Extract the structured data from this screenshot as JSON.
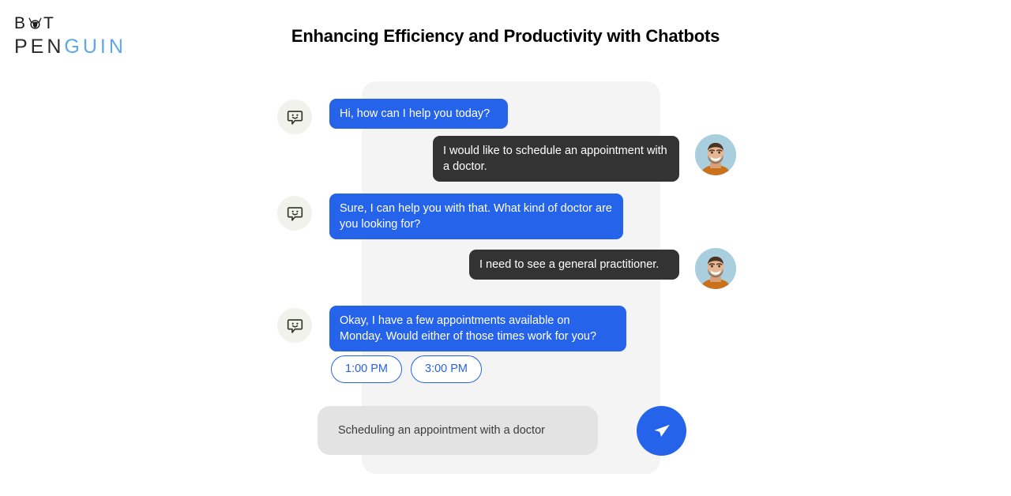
{
  "brand": {
    "line1_prefix": "B",
    "line1_suffix": "T",
    "line2_dark": "PEN",
    "line2_accent": "GUIN",
    "accent_color": "#5ea8e8",
    "dark_color": "#2b2b2b"
  },
  "header": {
    "title": "Enhancing Efficiency and Productivity with Chatbots"
  },
  "theme": {
    "bot_bubble_color": "#2563eb",
    "user_bubble_color": "#333333",
    "panel_color": "#f4f4f4",
    "chip_border_color": "#2563eb",
    "send_button_color": "#2563eb",
    "input_background": "#e3e3e3",
    "bot_avatar_background": "#f1f2ec"
  },
  "conversation": {
    "messages": [
      {
        "sender": "bot",
        "avatar": "bot-smiley-chat-icon",
        "text": "Hi, how can I help you today?"
      },
      {
        "sender": "user",
        "avatar": "user-photo-avatar",
        "text": "I would like to schedule an appointment with a doctor."
      },
      {
        "sender": "bot",
        "avatar": "bot-smiley-chat-icon",
        "text": "Sure, I can help you with that. What kind of doctor are you looking for?"
      },
      {
        "sender": "user",
        "avatar": "user-photo-avatar",
        "text": "I need to see a general practitioner."
      },
      {
        "sender": "bot",
        "avatar": "bot-smiley-chat-icon",
        "text": "Okay, I have a few appointments available on Monday. Would either of those times work for you?"
      }
    ],
    "quick_replies": [
      {
        "label": "1:00 PM"
      },
      {
        "label": "3:00 PM"
      }
    ]
  },
  "composer": {
    "value": "Scheduling an appointment with a doctor",
    "placeholder": "Scheduling an appointment with a doctor",
    "send_icon": "paper-plane-icon"
  }
}
